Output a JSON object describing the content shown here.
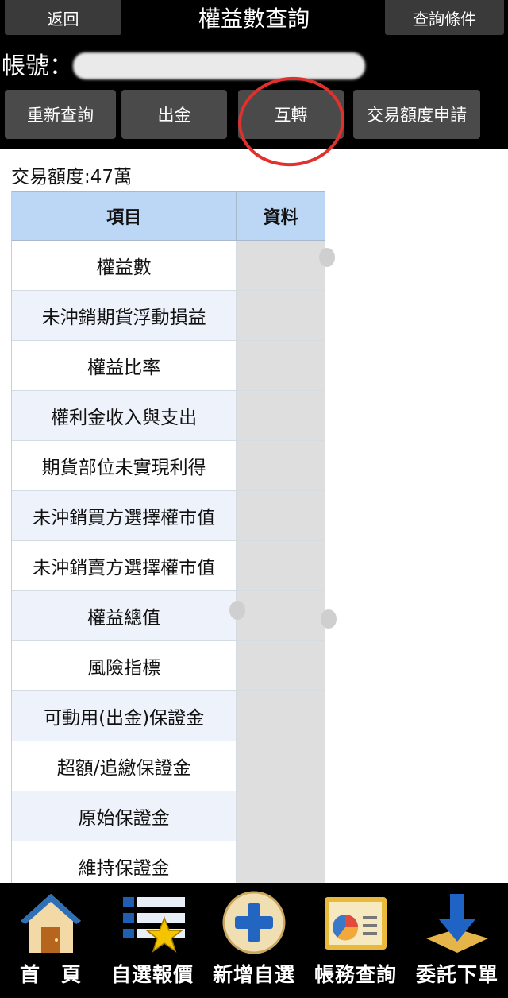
{
  "header": {
    "back_label": "返回",
    "title": "權益數查詢",
    "conditions_label": "查詢條件",
    "account_label": "帳號："
  },
  "actions": [
    {
      "label": "重新查詢"
    },
    {
      "label": "出金"
    },
    {
      "label": "互轉"
    },
    {
      "label": "交易額度申請"
    }
  ],
  "quota_text": "交易額度:47萬",
  "table": {
    "headers": {
      "item": "項目",
      "data": "資料"
    },
    "rows": [
      {
        "name": "權益數"
      },
      {
        "name": "未沖銷期貨浮動損益"
      },
      {
        "name": "權益比率"
      },
      {
        "name": "權利金收入與支出"
      },
      {
        "name": "期貨部位未實現利得"
      },
      {
        "name": "未沖銷買方選擇權市值"
      },
      {
        "name": "未沖銷賣方選擇權市值"
      },
      {
        "name": "權益總值"
      },
      {
        "name": "風險指標"
      },
      {
        "name": "可動用(出金)保證金"
      },
      {
        "name": "超額/追繳保證金"
      },
      {
        "name": "原始保證金"
      },
      {
        "name": "維持保證金"
      }
    ]
  },
  "bottom_nav": [
    {
      "label": "首　頁",
      "icon": "home-icon"
    },
    {
      "label": "自選報價",
      "icon": "watchlist-icon"
    },
    {
      "label": "新增自選",
      "icon": "add-icon"
    },
    {
      "label": "帳務查詢",
      "icon": "accounting-icon"
    },
    {
      "label": "委託下單",
      "icon": "order-icon"
    }
  ],
  "colors": {
    "header_bg": "#000000",
    "table_header_bg": "#bcd6f5",
    "annotation_red": "#e0312c"
  }
}
